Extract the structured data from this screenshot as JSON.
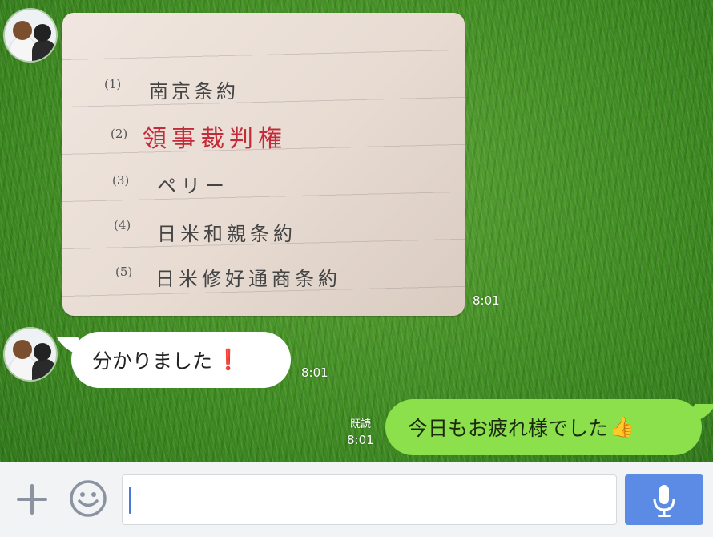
{
  "messages": {
    "photo": {
      "time": "8:01",
      "note_lines": [
        {
          "num": "(1)",
          "text": "南京条約"
        },
        {
          "num": "(2)",
          "text": "領事裁判権"
        },
        {
          "num": "(3)",
          "text": "ペリー"
        },
        {
          "num": "(4)",
          "text": "日米和親条約"
        },
        {
          "num": "(5)",
          "text": "日米修好通商条約"
        }
      ]
    },
    "incoming": {
      "text": "分かりました",
      "emoji": "❗",
      "time": "8:01"
    },
    "outgoing": {
      "text": "今日もお疲れ様でした",
      "emoji": "👍",
      "read_label": "既読",
      "time": "8:01"
    }
  },
  "input_bar": {
    "plus_icon": "plus-icon",
    "emoji_icon": "smiley-icon",
    "mic_icon": "microphone-icon",
    "text_value": ""
  },
  "colors": {
    "outgoing_bubble": "#8ce04c",
    "incoming_bubble": "#ffffff",
    "send_button": "#5b8be4",
    "highlight_ink": "#c42b3a"
  }
}
